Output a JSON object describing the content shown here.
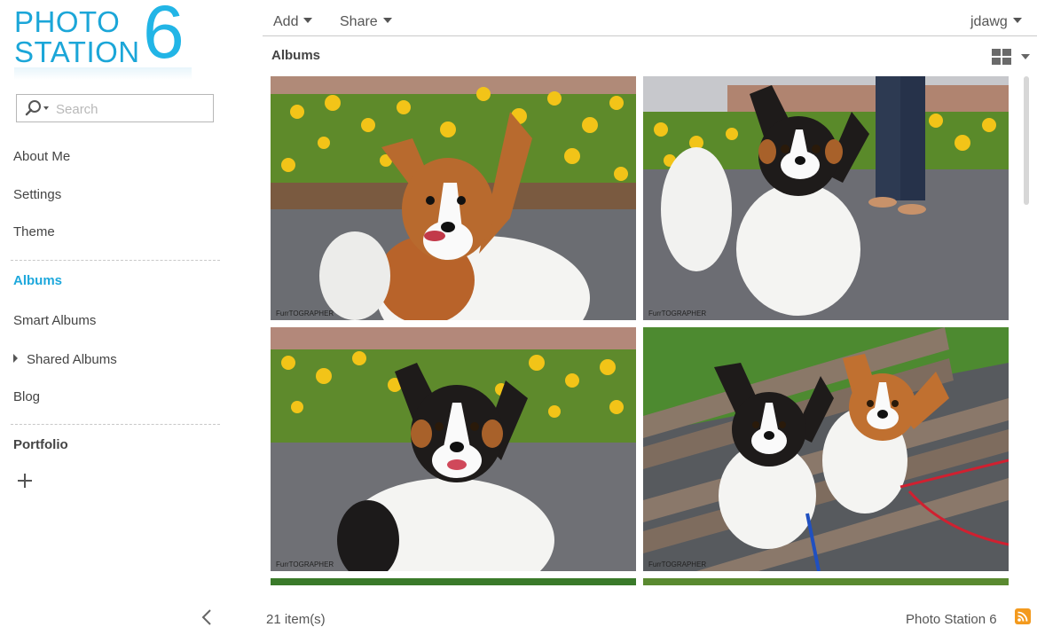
{
  "app": {
    "logo_line1": "PHOTO",
    "logo_line2": "STATION",
    "logo_version": "6"
  },
  "sidebar": {
    "search": {
      "placeholder": "Search",
      "value": ""
    },
    "items": [
      {
        "label": "About Me"
      },
      {
        "label": "Settings"
      },
      {
        "label": "Theme"
      },
      {
        "label": "Albums",
        "active": true
      },
      {
        "label": "Smart Albums"
      },
      {
        "label": "Shared Albums",
        "expandable": true
      },
      {
        "label": "Blog"
      },
      {
        "label": "Portfolio"
      }
    ]
  },
  "topbar": {
    "add_label": "Add",
    "share_label": "Share",
    "user_label": "jdawg"
  },
  "main": {
    "section_title": "Albums",
    "albums": [
      {
        "watermark": "FurrTOGRAPHER",
        "subject": "papillon-brown-white-flowers"
      },
      {
        "watermark": "FurrTOGRAPHER",
        "subject": "papillon-tricolor-standing-path"
      },
      {
        "watermark": "FurrTOGRAPHER",
        "subject": "papillon-tricolor-sitting-flowers"
      },
      {
        "watermark": "FurrTOGRAPHER",
        "subject": "two-papillons-on-bench"
      }
    ]
  },
  "footer": {
    "item_count": "21 item(s)",
    "brand": "Photo Station 6"
  },
  "colors": {
    "accent": "#1ea8dc",
    "rss": "#f39a1e"
  }
}
